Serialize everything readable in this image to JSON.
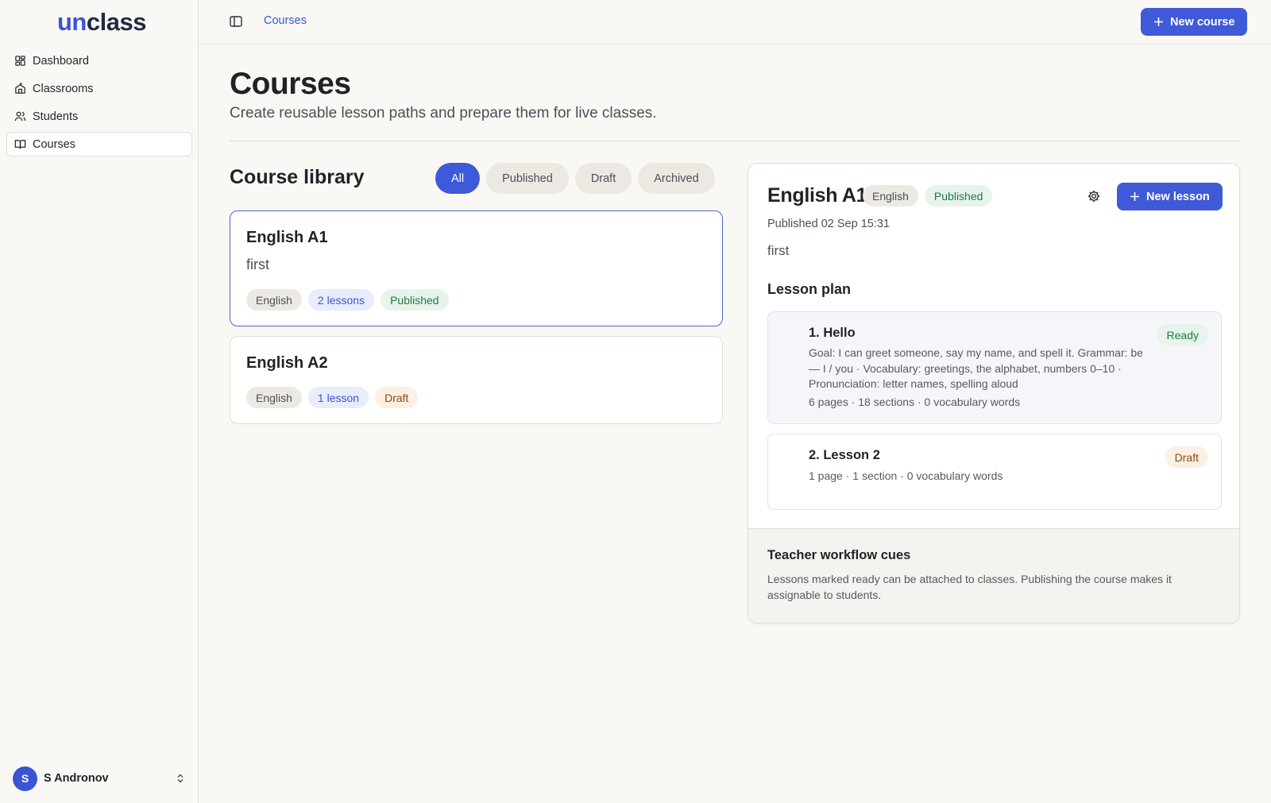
{
  "app": {
    "logo_part1": "un",
    "logo_part2": "class"
  },
  "sidebar": {
    "items": [
      {
        "label": "Dashboard",
        "icon": "dashboard-icon"
      },
      {
        "label": "Classrooms",
        "icon": "classroom-icon"
      },
      {
        "label": "Students",
        "icon": "students-icon"
      },
      {
        "label": "Courses",
        "icon": "book-icon",
        "active": true
      }
    ],
    "user": {
      "initial": "S",
      "name": "S Andronov"
    }
  },
  "header": {
    "breadcrumb": "Courses",
    "new_course_label": "New course"
  },
  "page": {
    "title": "Courses",
    "subtitle": "Create reusable lesson paths and prepare them for live classes."
  },
  "library": {
    "title": "Course library",
    "filters": [
      "All",
      "Published",
      "Draft",
      "Archived"
    ],
    "active_filter": "All",
    "courses": [
      {
        "name": "English A1",
        "description": "first",
        "language": "English",
        "lessons": "2 lessons",
        "status": "Published"
      },
      {
        "name": "English A2",
        "description": "",
        "language": "English",
        "lessons": "1 lesson",
        "status": "Draft"
      }
    ]
  },
  "detail": {
    "title": "English A1",
    "language": "English",
    "status": "Published",
    "new_lesson_label": "New lesson",
    "published_at": "Published 02 Sep 15:31",
    "description": "first",
    "plan_title": "Lesson plan",
    "lessons": [
      {
        "title": "1. Hello",
        "goal": "Goal: I can greet someone, say my name, and spell it. Grammar: be — I / you · Vocabulary: greetings, the alphabet, numbers 0–10 · Pronunciation: letter names, spelling aloud",
        "meta": "6 pages · 18 sections · 0 vocabulary words",
        "status": "Ready"
      },
      {
        "title": "2. Lesson 2",
        "goal": "",
        "meta": "1 page · 1 section · 0 vocabulary words",
        "status": "Draft"
      }
    ],
    "cues_title": "Teacher workflow cues",
    "cues_text": "Lessons marked ready can be attached to classes. Publishing the course makes it assignable to students."
  },
  "colors": {
    "accent": "#3f5ad8",
    "background": "#faf8f4",
    "published": "#1e7a45",
    "draft": "#8a4a12"
  }
}
